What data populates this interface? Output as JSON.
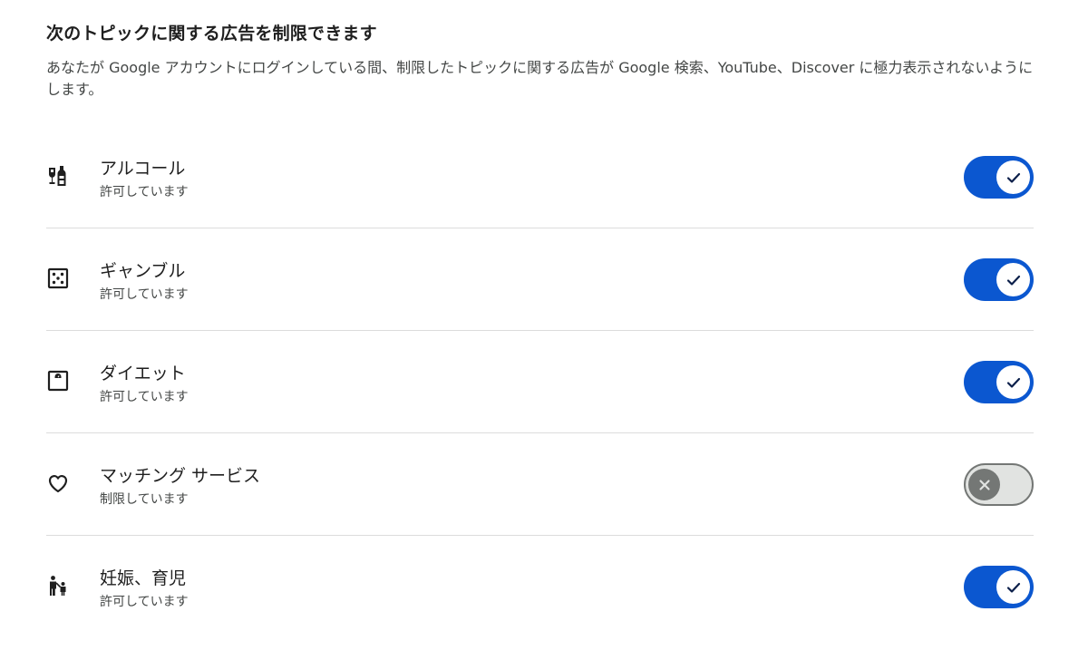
{
  "header": {
    "title": "次のトピックに関する広告を制限できます",
    "description": "あなたが Google アカウントにログインしている間、制限したトピックに関する広告が Google 検索、YouTube、Discover に極力表示されないようにします。"
  },
  "topics": [
    {
      "icon": "alcohol-icon",
      "label": "アルコール",
      "status": "許可しています",
      "enabled": true
    },
    {
      "icon": "dice-icon",
      "label": "ギャンブル",
      "status": "許可しています",
      "enabled": true
    },
    {
      "icon": "scale-icon",
      "label": "ダイエット",
      "status": "許可しています",
      "enabled": true
    },
    {
      "icon": "heart-icon",
      "label": "マッチング サービス",
      "status": "制限しています",
      "enabled": false
    },
    {
      "icon": "family-icon",
      "label": "妊娠、育児",
      "status": "許可しています",
      "enabled": true
    }
  ],
  "colors": {
    "toggle_on": "#0b57d0",
    "toggle_off_track": "#e1e3e1",
    "toggle_off_knob": "#747775",
    "divider": "#dcdcdc"
  }
}
